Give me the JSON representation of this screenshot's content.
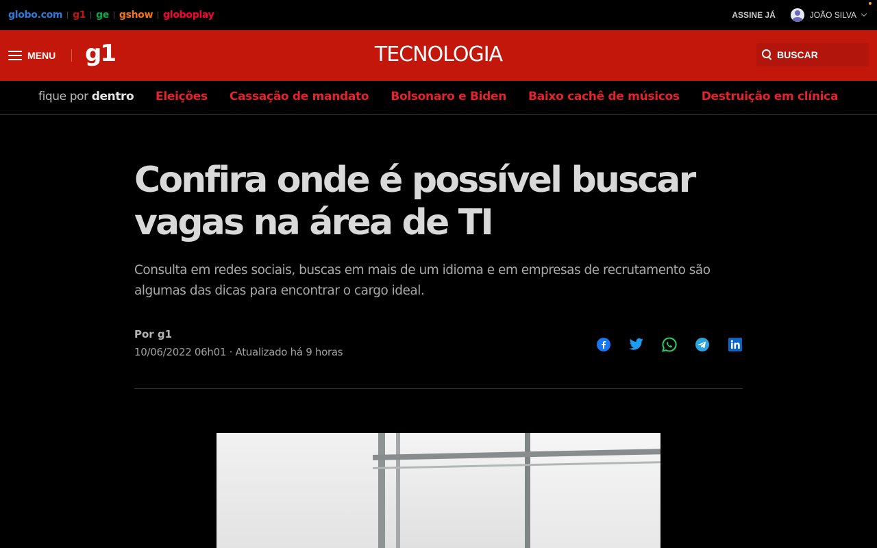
{
  "topbar": {
    "brands": [
      {
        "label": "globo.com",
        "color": "#2b7bd8"
      },
      {
        "label": "g1",
        "color": "#c4170c"
      },
      {
        "label": "ge",
        "color": "#06aa48"
      },
      {
        "label": "gshow",
        "color": "#f67419"
      },
      {
        "label": "globoplay",
        "color": "#fb0234"
      }
    ],
    "separator": "|",
    "subscribe_label": "ASSINE JÁ",
    "user_name": "JOÃO SILVA"
  },
  "header": {
    "menu_label": "MENU",
    "logo": "g1",
    "section_title": "TECNOLOGIA",
    "search_label": "BUSCAR",
    "background_color": "#c4170c"
  },
  "trending": {
    "prefix_light": "fique por ",
    "prefix_bold": "dentro",
    "links": [
      "Eleições",
      "Cassação de mandato",
      "Bolsonaro e Biden",
      "Baixo cachê de músicos",
      "Destruição em clínica"
    ]
  },
  "article": {
    "headline": "Confira onde é possível buscar vagas na área de TI",
    "subtitle": "Consulta em redes sociais, buscas em mais de um idioma e em empresas de recrutamento são algumas das dicas para encontrar o cargo ideal.",
    "author": "Por g1",
    "date": "10/06/2022 06h01 · Atualizado há 9 horas",
    "share": [
      {
        "icon": "facebook-icon",
        "color": "#1877f2"
      },
      {
        "icon": "twitter-icon",
        "color": "#1d9bf0"
      },
      {
        "icon": "whatsapp-icon",
        "color": "#25d366"
      },
      {
        "icon": "telegram-icon",
        "color": "#2aa3de"
      },
      {
        "icon": "linkedin-icon",
        "color": "#0a66c2"
      }
    ]
  }
}
